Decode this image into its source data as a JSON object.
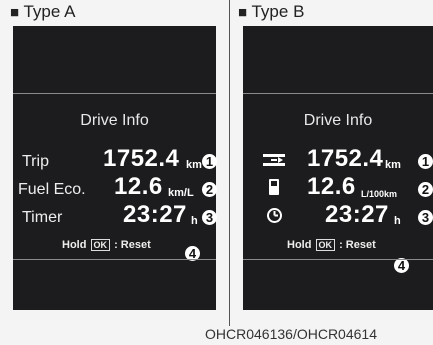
{
  "captions": {
    "a_marker": "■",
    "a_text": "Type A",
    "b_marker": "■",
    "b_text": "Type B"
  },
  "panel_a": {
    "title": "Drive Info",
    "rows": [
      {
        "label": "Trip",
        "value": "1752.4",
        "unit": "km",
        "marker": "1"
      },
      {
        "label": "Fuel Eco.",
        "value": "12.6",
        "unit": "km/L",
        "marker": "2"
      },
      {
        "label": "Timer",
        "value": "23:27",
        "unit": "h",
        "marker": "3"
      }
    ],
    "hold_prefix": "Hold",
    "hold_ok": "OK",
    "hold_suffix": ": Reset",
    "hold_marker": "4"
  },
  "panel_b": {
    "title": "Drive Info",
    "rows": [
      {
        "icon": "road-icon",
        "value": "1752.4",
        "unit": "km",
        "marker": "1"
      },
      {
        "icon": "fuel-pump-icon",
        "value": "12.6",
        "unit": "L/100km",
        "marker": "2"
      },
      {
        "icon": "clock-icon",
        "value": "23:27",
        "unit": "h",
        "marker": "3"
      }
    ],
    "hold_prefix": "Hold",
    "hold_ok": "OK",
    "hold_suffix": ": Reset",
    "hold_marker": "4"
  },
  "image_code": "OHCR046136/OHCR04614"
}
